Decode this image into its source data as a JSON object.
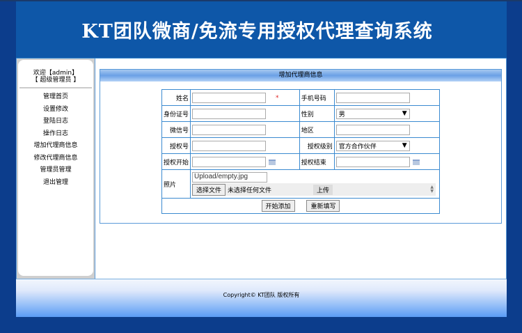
{
  "header": {
    "title": "KT团队微商/免流专用授权代理查询系统"
  },
  "sidebar": {
    "welcome_line1": "欢迎【admin】",
    "welcome_line2": "【 超级管理员 】",
    "items": [
      {
        "label": "管理首页"
      },
      {
        "label": "设置修改"
      },
      {
        "label": "登陆日志"
      },
      {
        "label": "操作日志"
      },
      {
        "label": "增加代理商信息"
      },
      {
        "label": "修改代理商信息"
      },
      {
        "label": "管理员管理"
      },
      {
        "label": "退出管理"
      }
    ]
  },
  "form": {
    "title": "增加代理商信息",
    "name_label": "姓名",
    "required_mark": "*",
    "phone_label": "手机号码",
    "id_label": "身份证号",
    "gender_label": "性别",
    "gender_value": "男",
    "wechat_label": "微信号",
    "region_label": "地区",
    "auth_no_label": "授权号",
    "auth_level_label": "授权级别",
    "auth_level_value": "官方合作伙伴",
    "auth_start_label": "授权开始",
    "auth_end_label": "授权结束",
    "photo_label": "照片",
    "photo_value": "Upload/empty.jpg",
    "choose_file": "选择文件",
    "no_file": "未选择任何文件",
    "upload": "上传",
    "submit": "开始添加",
    "reset": "重新填写"
  },
  "footer": {
    "copyright": "Copyright© KT团队 版权所有"
  }
}
